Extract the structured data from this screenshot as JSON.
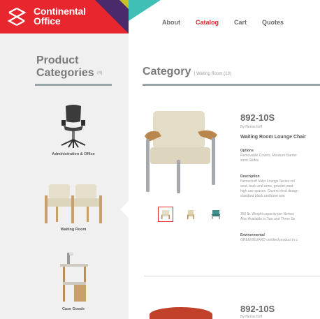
{
  "brand": {
    "name_line1": "Continental",
    "name_line2": "Office"
  },
  "nav": {
    "items": [
      {
        "label": "About",
        "active": false
      },
      {
        "label": "Catalog",
        "active": true
      },
      {
        "label": "Cart",
        "active": false
      },
      {
        "label": "Quotes",
        "active": false
      }
    ]
  },
  "sidebar": {
    "title_line1": "Product",
    "title_line2": "Categories",
    "count": "(4)",
    "categories": [
      {
        "label": "Administration & Office"
      },
      {
        "label": "Waiting Room"
      },
      {
        "label": "Case Goods"
      }
    ]
  },
  "main": {
    "title": "Category",
    "subtitle": "| Waiting Room (13)",
    "product1": {
      "code": "892-10S",
      "by": "By Nemschoff",
      "name": "Waiting Room Lounge Chair",
      "options_heading": "Options",
      "options_text_1": "Removable Covers, Moisture Barrier",
      "options_text_2": "sono Glides",
      "description_heading": "Description",
      "description_lines": [
        "Nemschoff Valor Lounge Series col",
        "seat, back and arms, powder-coat",
        "high use spaces. Covers ideal design",
        "standard black urethane arm"
      ],
      "capacity_line_1": "350 lb. Weight capacity per Nemsc",
      "capacity_line_2": "Also Available in Two and Three Se",
      "environmental_heading": "Environmental",
      "environmental_text": "GREENGUARD certified product in c"
    },
    "product2": {
      "code": "892-10S",
      "by": "By Nemschoff"
    }
  },
  "colors": {
    "brand_red": "#e8262e",
    "purple": "#4a2a6a",
    "teal": "#3fbfb6",
    "rule_gray": "#9aa5ab"
  }
}
